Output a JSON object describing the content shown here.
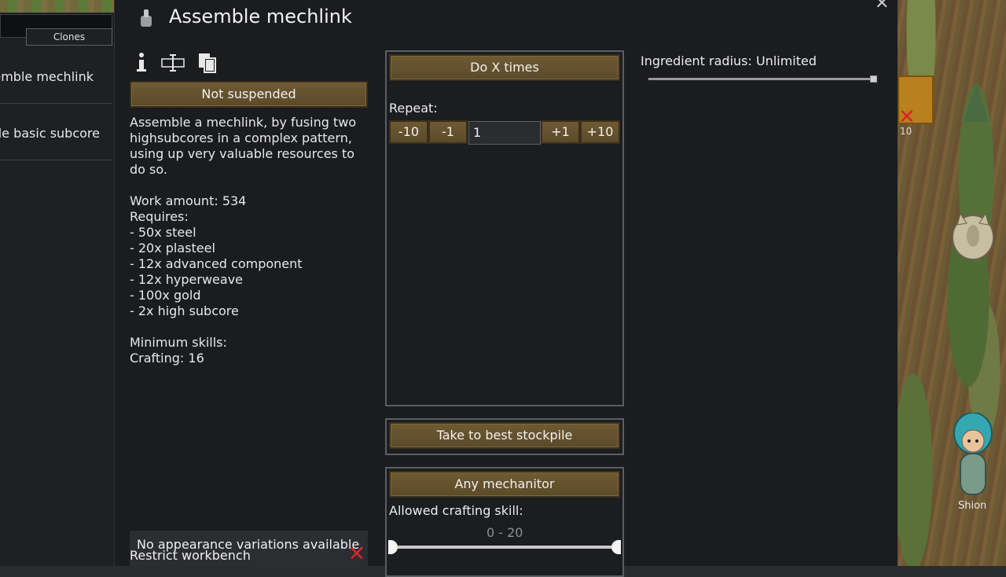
{
  "dialog": {
    "title": "Assemble mechlink",
    "suspend_button": "Not suspended",
    "description": "Assemble a mechlink, by fusing two highsubcores in a complex pattern, using up very valuable resources to do so.\n\nWork amount: 534\nRequires:\n - 50x steel\n - 20x plasteel\n - 12x advanced component\n - 12x hyperweave\n - 100x gold\n - 2x high subcore\n\nMinimum skills:\n   Crafting: 16",
    "repeat_mode_button": "Do X times",
    "repeat_label": "Repeat:",
    "repeat_buttons": [
      "-10",
      "-1",
      "+1",
      "+10"
    ],
    "repeat_value": "1",
    "store_mode_button": "Take to best stockpile",
    "worker_button": "Any mechanitor",
    "skill_label": "Allowed crafting skill:",
    "skill_range": "0 - 20",
    "ingredient_radius_label": "Ingredient radius: Unlimited",
    "no_variations": "No appearance variations available.",
    "restrict_workbench": "Restrict workbench"
  },
  "bill_list": {
    "tab_label": "Clones",
    "items": [
      "Assemble mechlink",
      "Assemble basic subcore"
    ]
  },
  "map": {
    "pawn_name": "Shion",
    "stack_count": "10"
  }
}
